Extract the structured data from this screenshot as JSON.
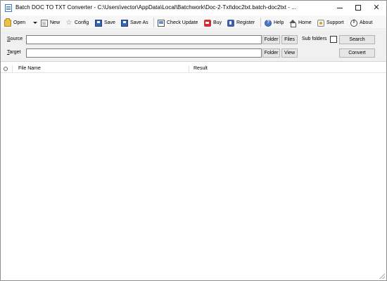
{
  "window": {
    "title": "Batch DOC TO TXT Converter - C:\\Users\\vector\\AppData\\Local\\Batchwork\\Doc-2-Txt\\doc2txt.batch-doc2txt - ..."
  },
  "toolbar": {
    "open_label": "Open",
    "new_label": "New",
    "config_label": "Config",
    "save_label": "Save",
    "save_as_label": "Save As",
    "check_update_label": "Check Update",
    "buy_label": "Buy",
    "register_label": "Register",
    "help_label": "Help",
    "home_label": "Home",
    "support_label": "Support",
    "about_label": "About"
  },
  "panel": {
    "source_label_prefix": "S",
    "source_label_rest": "ource",
    "target_label_prefix": "T",
    "target_label_rest": "arget",
    "source_value": "",
    "target_value": "",
    "source_folder_button": "Folder",
    "source_files_button": "Files",
    "target_folder_button": "Folder",
    "target_view_button": "View",
    "subfolders_label": "Sub folders",
    "subfolders_checked": false,
    "search_button": "Search",
    "convert_button": "Convert"
  },
  "list": {
    "columns": [
      "File Name",
      "Result"
    ],
    "rows": []
  }
}
